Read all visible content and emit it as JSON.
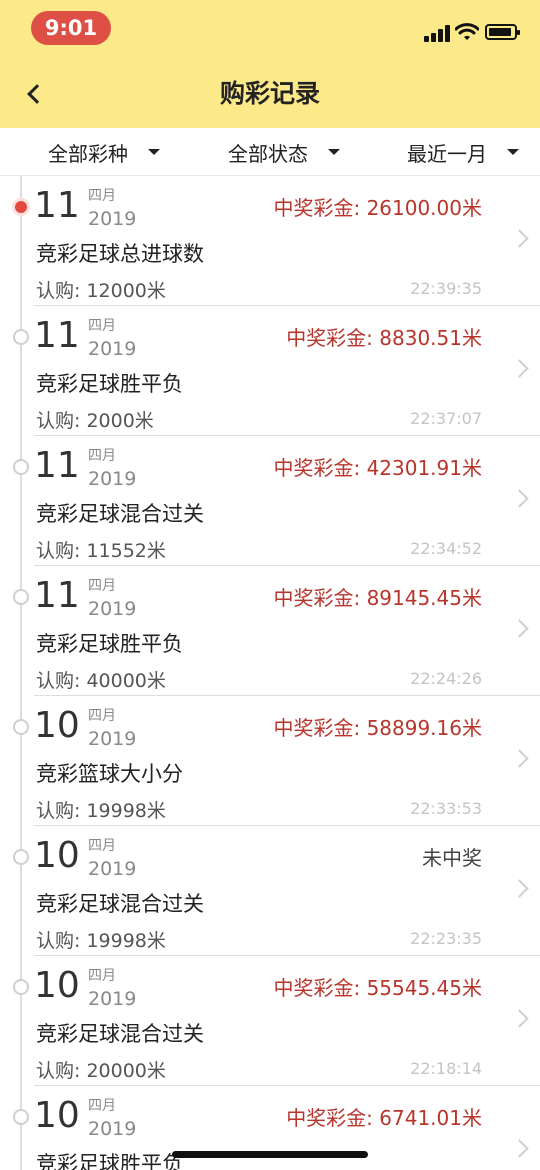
{
  "status": {
    "time": "9:01"
  },
  "header": {
    "title": "购彩记录"
  },
  "filters": [
    {
      "label": "全部彩种"
    },
    {
      "label": "全部状态"
    },
    {
      "label": "最近一月"
    }
  ],
  "records": [
    {
      "day": "11",
      "month": "四月",
      "year": "2019",
      "prize": "中奖彩金: 26100.00米",
      "won": true,
      "game": "竞彩足球总进球数",
      "amount": "认购: 12000米",
      "time": "22:39:35"
    },
    {
      "day": "11",
      "month": "四月",
      "year": "2019",
      "prize": "中奖彩金: 8830.51米",
      "won": true,
      "game": "竞彩足球胜平负",
      "amount": "认购: 2000米",
      "time": "22:37:07"
    },
    {
      "day": "11",
      "month": "四月",
      "year": "2019",
      "prize": "中奖彩金: 42301.91米",
      "won": true,
      "game": "竞彩足球混合过关",
      "amount": "认购: 11552米",
      "time": "22:34:52"
    },
    {
      "day": "11",
      "month": "四月",
      "year": "2019",
      "prize": "中奖彩金: 89145.45米",
      "won": true,
      "game": "竞彩足球胜平负",
      "amount": "认购: 40000米",
      "time": "22:24:26"
    },
    {
      "day": "10",
      "month": "四月",
      "year": "2019",
      "prize": "中奖彩金: 58899.16米",
      "won": true,
      "game": "竞彩篮球大小分",
      "amount": "认购: 19998米",
      "time": "22:33:53"
    },
    {
      "day": "10",
      "month": "四月",
      "year": "2019",
      "prize": "未中奖",
      "won": false,
      "game": "竞彩足球混合过关",
      "amount": "认购: 19998米",
      "time": "22:23:35"
    },
    {
      "day": "10",
      "month": "四月",
      "year": "2019",
      "prize": "中奖彩金: 55545.45米",
      "won": true,
      "game": "竞彩足球混合过关",
      "amount": "认购: 20000米",
      "time": "22:18:14"
    },
    {
      "day": "10",
      "month": "四月",
      "year": "2019",
      "prize": "中奖彩金: 6741.01米",
      "won": true,
      "game": "竞彩足球胜平负",
      "amount": "",
      "time": ""
    }
  ]
}
